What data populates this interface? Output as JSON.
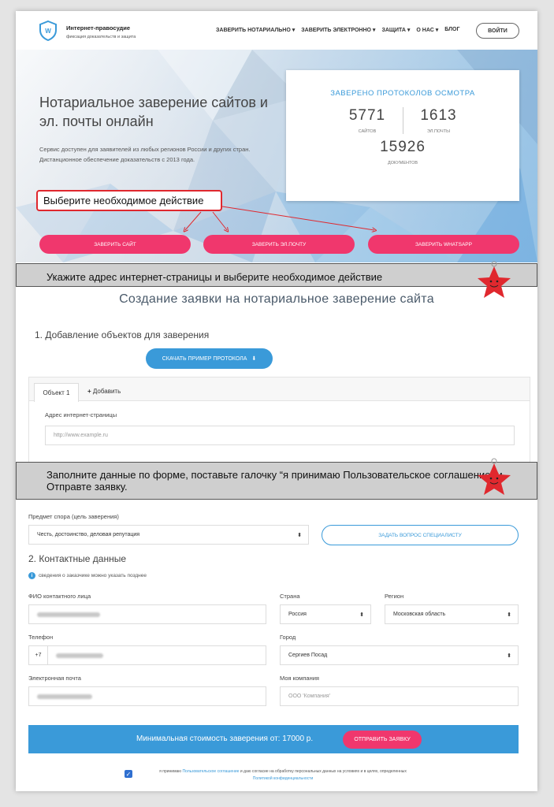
{
  "header": {
    "brand_name": "Интернет-правосудие",
    "brand_tagline": "фиксация доказательств и защита",
    "logo_letter": "W",
    "nav": [
      "ЗАВЕРИТЬ НОТАРИАЛЬНО",
      "ЗАВЕРИТЬ ЭЛЕКТРОННО",
      "ЗАЩИТА",
      "О НАС",
      "БЛОГ"
    ],
    "login_label": "ВОЙТИ"
  },
  "hero": {
    "title": "Нотариальное заверение сайтов и эл. почты онлайн",
    "text": "Сервис доступен для заявителей из любых регионов России и других стран. Дистанционное обеспечение доказательств с 2013 года.",
    "stats_title": "ЗАВЕРЕНО ПРОТОКОЛОВ ОСМОТРА",
    "stats": [
      {
        "value": "5771",
        "label": "САЙТОВ"
      },
      {
        "value": "1613",
        "label": "ЭЛ.ПОЧТЫ"
      },
      {
        "value": "15926",
        "label": "ДОКУМЕНТОВ"
      }
    ],
    "buttons": [
      "ЗАВЕРИТЬ САЙТ",
      "ЗАВЕРИТЬ ЭЛ.ПОЧТУ",
      "ЗАВЕРИТЬ WHATSAPP"
    ]
  },
  "annotations": {
    "callout": "Выберите необходимое действие",
    "banner1": "Укажите адрес интернет-страницы и выберите необходимое действие",
    "banner2": "Заполните данные по форме, поставьте галочку “я принимаю Пользовательское соглашение” и Отправте заявку."
  },
  "form": {
    "title": "Создание заявки на нотариальное заверение сайта",
    "section1": "1. Добавление объектов для заверения",
    "download_button": "СКАЧАТЬ ПРИМЕР ПРОТОКОЛА",
    "tab_active": "Объект 1",
    "tab_add": "Добавить",
    "url_label": "Адрес интернет-страницы",
    "url_placeholder": "http://www.example.ru",
    "subject_label": "Предмет спора (цель заверения)",
    "subject_value": "Честь, достоинство, деловая репутация",
    "ask_button": "ЗАДАТЬ ВОПРОС СПЕЦИАЛИСТУ",
    "section2": "2. Контактные данные",
    "note": "сведения о заказчике можно указать позднее",
    "fio_label": "ФИО контактного лица",
    "country_label": "Страна",
    "country_value": "Россия",
    "region_label": "Регион",
    "region_value": "Московская область",
    "phone_label": "Телефон",
    "phone_prefix": "+7",
    "city_label": "Город",
    "city_value": "Сергиев Посад",
    "email_label": "Электронная почта",
    "company_label": "Моя компания",
    "company_placeholder": "ООО 'Компания'",
    "cost_text": "Минимальная стоимость заверения от: 17000 р.",
    "send_button": "ОТПРАВИТЬ ЗАЯВКУ",
    "agree_prefix": "я принимаю",
    "agree_link1": "Пользовательское соглашение",
    "agree_middle": "и даю согласие на обработку персональных данных на условиях и в целях, определенных",
    "agree_link2": "Политикой конфиденциальности"
  },
  "colors": {
    "accent_blue": "#3a9ad9",
    "accent_pink": "#f0376d",
    "callout_red": "#e0282e"
  },
  "icons": [
    "shield-logo-icon",
    "download-icon",
    "plus-icon",
    "info-icon",
    "select-arrows-icon",
    "checkbox-icon",
    "star-mascot-icon"
  ]
}
